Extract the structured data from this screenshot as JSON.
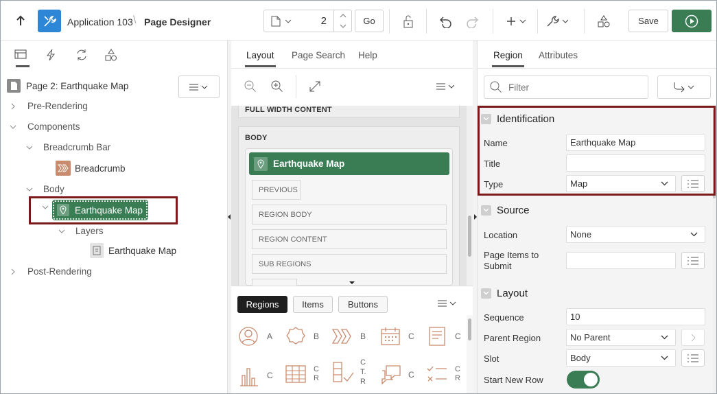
{
  "toolbar": {
    "app_name": "Application 103",
    "page_designer": "Page Designer",
    "page_number": "2",
    "go_label": "Go",
    "save_label": "Save"
  },
  "left": {
    "page_title": "Page 2: Earthquake Map",
    "tree": {
      "pre_rendering": "Pre-Rendering",
      "components": "Components",
      "breadcrumb_bar": "Breadcrumb Bar",
      "breadcrumb": "Breadcrumb",
      "body": "Body",
      "earthquake_map": "Earthquake Map",
      "layers": "Layers",
      "layer_earthquake_map": "Earthquake Map",
      "post_rendering": "Post-Rendering"
    }
  },
  "middle": {
    "tabs": [
      "Layout",
      "Page Search",
      "Help"
    ],
    "canvas": {
      "full_width": "FULL WIDTH CONTENT",
      "body": "BODY",
      "region_title": "Earthquake Map",
      "previous": "PREVIOUS",
      "region_body": "REGION BODY",
      "region_content": "REGION CONTENT",
      "sub_regions": "SUB REGIONS"
    },
    "gallery": {
      "tabs": [
        "Regions",
        "Items",
        "Buttons"
      ],
      "row1_labels": [
        "A",
        "B",
        "B",
        "C",
        "C"
      ],
      "row2_labels": [
        "C",
        "C\nR",
        "C\nT.\nR",
        "C",
        "C\nR"
      ]
    }
  },
  "right": {
    "tabs": [
      "Region",
      "Attributes"
    ],
    "filter_placeholder": "Filter",
    "identification": {
      "heading": "Identification",
      "name_label": "Name",
      "name_value": "Earthquake Map",
      "title_label": "Title",
      "title_value": "",
      "type_label": "Type",
      "type_value": "Map"
    },
    "source": {
      "heading": "Source",
      "location_label": "Location",
      "location_value": "None",
      "page_items_label": "Page Items to Submit",
      "page_items_value": ""
    },
    "layout": {
      "heading": "Layout",
      "sequence_label": "Sequence",
      "sequence_value": "10",
      "parent_label": "Parent Region",
      "parent_value": "No Parent",
      "slot_label": "Slot",
      "slot_value": "Body",
      "new_row_label": "Start New Row"
    }
  },
  "colors": {
    "accent_green": "#3a7d55",
    "highlight": "#7b1a1a",
    "app_icon_blue": "#2d86d6"
  }
}
